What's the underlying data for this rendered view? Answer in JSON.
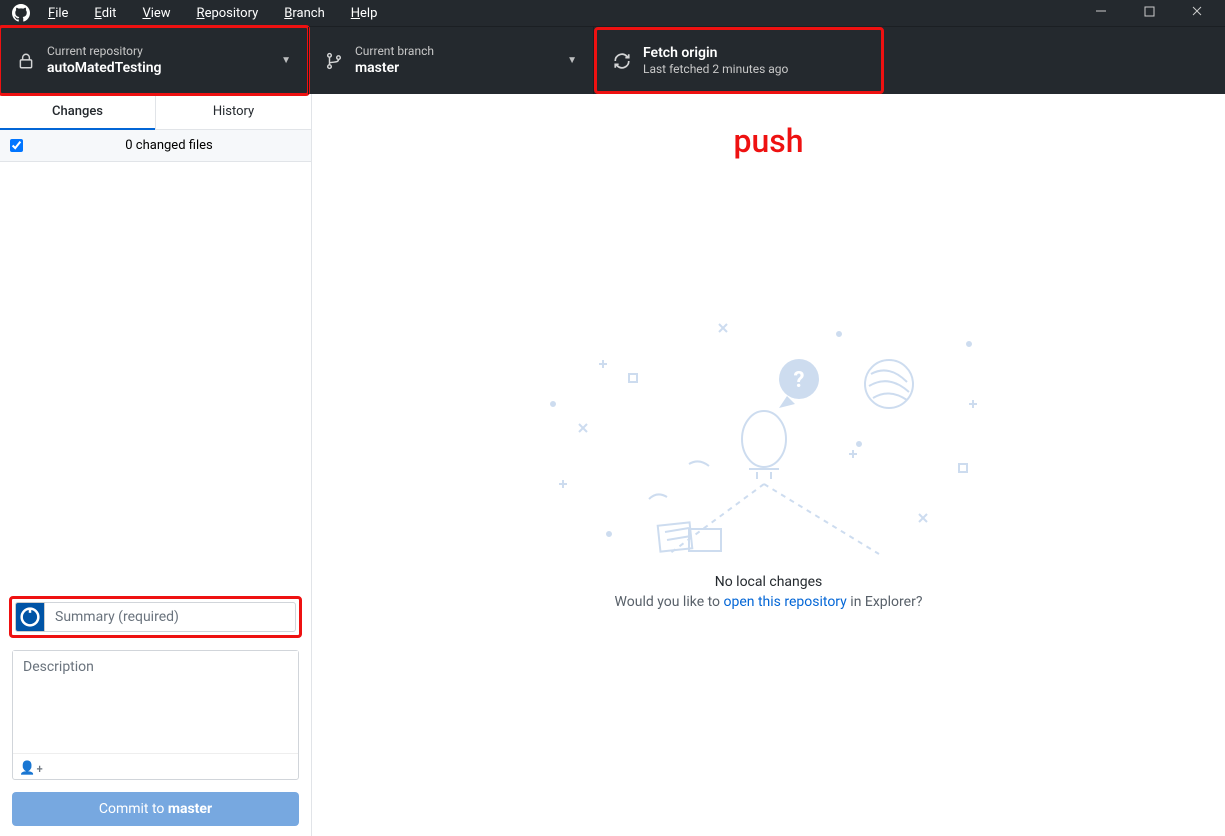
{
  "menu": {
    "file": "File",
    "edit": "Edit",
    "view": "View",
    "repository": "Repository",
    "branch": "Branch",
    "help": "Help"
  },
  "toolbar": {
    "repo_label": "Current repository",
    "repo_name": "autoMatedTesting",
    "branch_label": "Current branch",
    "branch_name": "master",
    "fetch_label": "Fetch origin",
    "fetch_sub": "Last fetched 2 minutes ago"
  },
  "tabs": {
    "changes": "Changes",
    "history": "History"
  },
  "changes": {
    "header": "0 changed files"
  },
  "commit": {
    "summary_placeholder": "Summary (required)",
    "description_placeholder": "Description",
    "button_prefix": "Commit to ",
    "button_branch": "master"
  },
  "main": {
    "annotation": "push",
    "empty_title": "No local changes",
    "empty_prefix": "Would you like to ",
    "empty_link": "open this repository",
    "empty_suffix": " in Explorer?"
  }
}
